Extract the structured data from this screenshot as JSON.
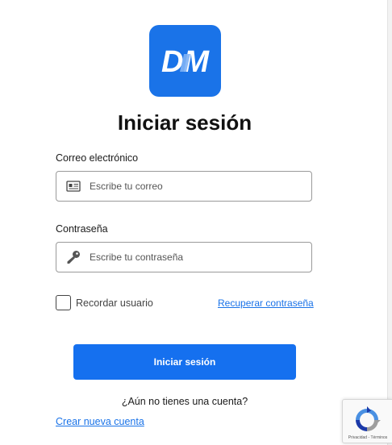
{
  "logo": {
    "text": "DM",
    "color": "#1a73e8"
  },
  "title": "Iniciar sesión",
  "email": {
    "label": "Correo electrónico",
    "placeholder": "Escribe tu correo",
    "value": "",
    "icon": "id-card-icon"
  },
  "password": {
    "label": "Contraseña",
    "placeholder": "Escribe tu contraseña",
    "value": "",
    "icon": "key-icon"
  },
  "remember": {
    "label": "Recordar usuario",
    "checked": false
  },
  "recover_link": "Recuperar contraseña",
  "submit_label": "Iniciar sesión",
  "no_account_text": "¿Aún no tienes una cuenta?",
  "create_account_link": "Crear nueva cuenta",
  "recaptcha": {
    "privacy": "Privacidad",
    "separator": " - ",
    "terms": "Términos"
  },
  "colors": {
    "accent": "#1570ef",
    "link": "#1a73e8"
  }
}
